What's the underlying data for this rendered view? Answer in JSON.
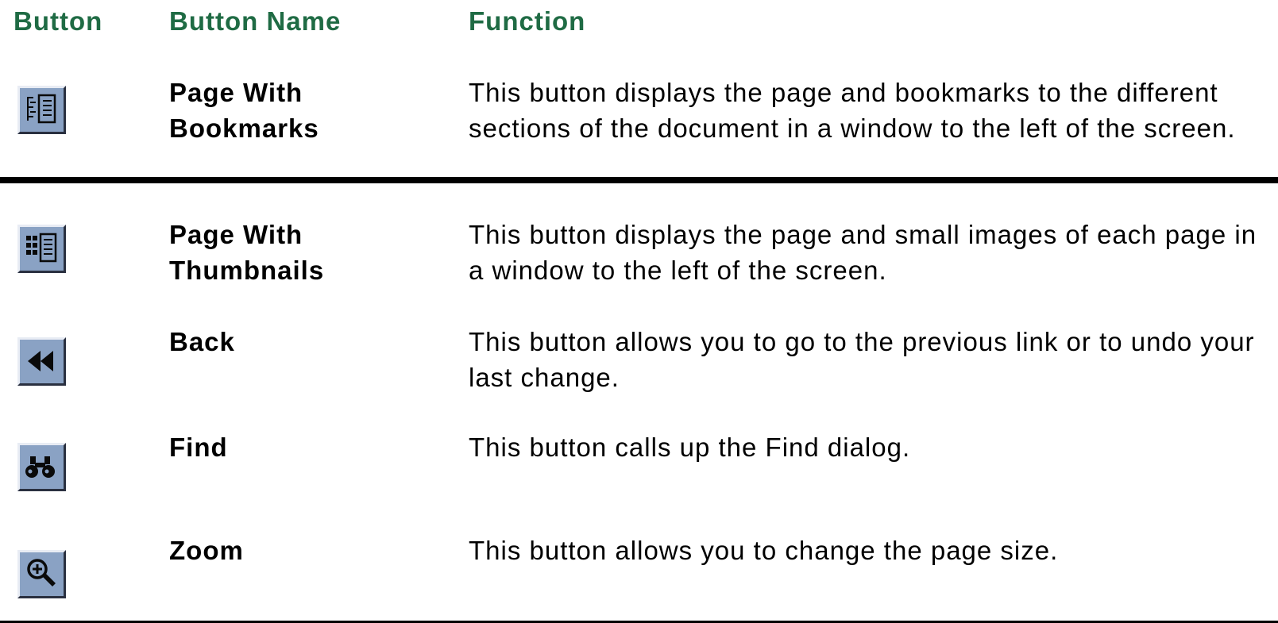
{
  "colors": {
    "header_text": "#1f6b44",
    "icon_face": "#8aa2c4",
    "icon_ink": "#0a0a0a"
  },
  "headers": {
    "button": "Button",
    "button_name": "Button Name",
    "function": "Function"
  },
  "rows": [
    {
      "icon": "page-with-bookmarks-icon",
      "name": "Page With Bookmarks",
      "function": "This button displays the page and bookmarks to the different sections of the document in a window to the left of the screen."
    },
    {
      "icon": "page-with-thumbnails-icon",
      "name": "Page With Thumbnails",
      "function": "This button displays the page and small images of each page in a window to the left of the screen."
    },
    {
      "icon": "back-icon",
      "name": "Back",
      "function": "This button allows you to go to the previous link or to undo your last change."
    },
    {
      "icon": "find-binoculars-icon",
      "name": "Find",
      "function": "This button calls up the Find dialog."
    },
    {
      "icon": "zoom-magnifier-icon",
      "name": "Zoom",
      "function": "This button allows you to change the page size."
    }
  ]
}
